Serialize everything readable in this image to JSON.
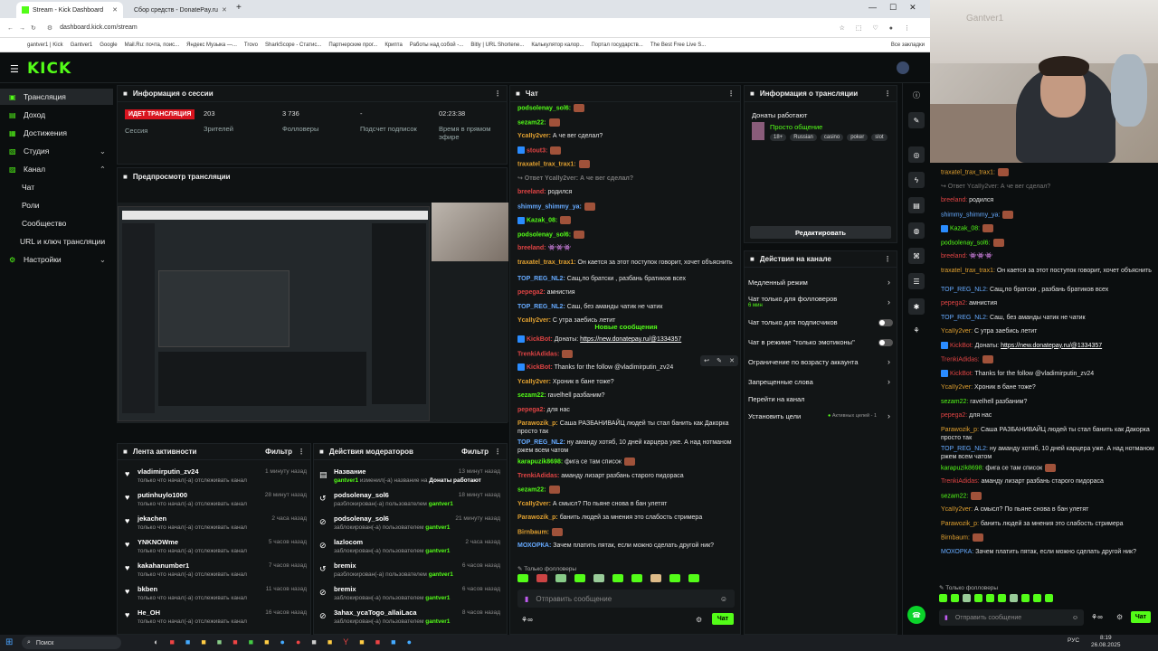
{
  "browser": {
    "tabs": [
      {
        "title": "Stream - Kick Dashboard",
        "active": true
      },
      {
        "title": "Сбор средств - DonatePay.ru",
        "active": false
      }
    ],
    "url": "dashboard.kick.com/stream",
    "bookmarks": [
      "gantver1 | Kick",
      "Gantver1",
      "Google",
      "Mail.Ru: почта, поис...",
      "Яндекс Музыка —...",
      "Trovo",
      "SharkScope - Статис...",
      "Партнерские прог...",
      "Крипта",
      "Работы над собой -...",
      "Bitly | URL Shortene...",
      "Калькулятор калор...",
      "Портал государств...",
      "The Best Free Live S..."
    ],
    "all_bookmarks": "Все закладки"
  },
  "sidebar": {
    "items": [
      {
        "label": "Трансляция",
        "icon": "broadcast-icon",
        "active": true
      },
      {
        "label": "Доход",
        "icon": "wallet-icon"
      },
      {
        "label": "Достижения",
        "icon": "trophy-icon"
      },
      {
        "label": "Студия",
        "icon": "studio-icon",
        "chevron": "down"
      },
      {
        "label": "Канал",
        "icon": "channel-icon",
        "chevron": "up"
      },
      {
        "label": "Чат",
        "sub": true
      },
      {
        "label": "Роли",
        "sub": true
      },
      {
        "label": "Сообщество",
        "sub": true
      },
      {
        "label": "URL и ключ трансляции",
        "sub": true
      },
      {
        "label": "Настройки",
        "icon": "gear-icon",
        "chevron": "down"
      }
    ]
  },
  "session": {
    "title": "Информация о сессии",
    "live_badge": "ИДЕТ ТРАНСЛЯЦИЯ",
    "session_label": "Сессия",
    "stats": [
      {
        "value": "203",
        "label": "Зрителей"
      },
      {
        "value": "3 736",
        "label": "Фолловеры"
      },
      {
        "value": "-",
        "label": "Подсчет подписок"
      },
      {
        "value": "02:23:38",
        "label": "Время в прямом эфире"
      }
    ]
  },
  "preview": {
    "title": "Предпросмотр трансляции"
  },
  "activity": {
    "title": "Лента активности",
    "filter": "Фильтр",
    "items": [
      {
        "name": "vladimirputin_zv24",
        "desc": "только что начал(-а) отслеживать канал",
        "time": "1 минуту назад"
      },
      {
        "name": "putinhuylo1000",
        "desc": "только что начал(-а) отслеживать канал",
        "time": "28 минут назад"
      },
      {
        "name": "jekachen",
        "desc": "только что начал(-а) отслеживать канал",
        "time": "2 часа назад"
      },
      {
        "name": "YNKNOWme",
        "desc": "только что начал(-а) отслеживать канал",
        "time": "5 часов назад"
      },
      {
        "name": "kakahanumber1",
        "desc": "только что начал(-а) отслеживать канал",
        "time": "7 часов назад"
      },
      {
        "name": "bkben",
        "desc": "только что начал(-а) отслеживать канал",
        "time": "11 часов назад"
      },
      {
        "name": "He_OH",
        "desc": "только что начал(-а) отслеживать канал",
        "time": "16 часов назад"
      }
    ]
  },
  "moderation": {
    "title": "Действия модераторов",
    "filter": "Фильтр",
    "items": [
      {
        "name": "Название",
        "desc_pre": "gantver1",
        "desc": " изменил(-а) название на ",
        "desc_post": "Донаты работают",
        "time": "13 минут назад",
        "icon": "rename-icon"
      },
      {
        "name": "podsolenay_sol6",
        "desc_pre": "",
        "desc": "разблокирован(-а) пользователем ",
        "desc_post": "gantver1",
        "time": "18 минут назад",
        "icon": "unban-icon"
      },
      {
        "name": "podsolenay_sol6",
        "desc_pre": "",
        "desc": "заблокирован(-а) пользователем ",
        "desc_post": "gantver1",
        "time": "21 минуту назад",
        "icon": "ban-icon"
      },
      {
        "name": "lazlocom",
        "desc_pre": "",
        "desc": "заблокирован(-а) пользователем ",
        "desc_post": "gantver1",
        "time": "2 часа назад",
        "icon": "ban-icon"
      },
      {
        "name": "bremix",
        "desc_pre": "",
        "desc": "разблокирован(-а) пользователем ",
        "desc_post": "gantver1",
        "time": "6 часов назад",
        "icon": "unban-icon"
      },
      {
        "name": "bremix",
        "desc_pre": "",
        "desc": "заблокирован(-а) пользователем ",
        "desc_post": "gantver1",
        "time": "6 часов назад",
        "icon": "ban-icon"
      },
      {
        "name": "3ahax_ycaTogo_allaiLaca",
        "desc_pre": "",
        "desc": "заблокирован(-а) пользователем ",
        "desc_post": "gantver1",
        "time": "8 часов назад",
        "icon": "ban-icon"
      }
    ]
  },
  "chat": {
    "title": "Чат",
    "new_messages": "Новые сообщения",
    "followers_only": "Только фолловеры",
    "placeholder": "Отправить сообщение",
    "send": "Чат",
    "messages": [
      {
        "user": "podsolenay_sol6:",
        "color": "#53fc18",
        "text": "",
        "emote": true
      },
      {
        "user": "sezam22:",
        "color": "#53fc18",
        "text": "",
        "emote": true
      },
      {
        "user": "YcaIIy2ver:",
        "color": "#e0a030",
        "text": "А че вег сделал?"
      },
      {
        "user": "stout3:",
        "color": "#e04444",
        "text": "",
        "emote": true,
        "badge": true
      },
      {
        "user": "traxatel_trax_trax1:",
        "color": "#e0a030",
        "text": "",
        "emote": true
      },
      {
        "user": "↪ Ответ YcaIIy2ver: А че вег сделал?",
        "color": "#777",
        "text": ""
      },
      {
        "user": "breeland:",
        "color": "#e04444",
        "text": "родился"
      },
      {
        "user": "shimmy_shimmy_ya:",
        "color": "#66aaff",
        "text": "",
        "emote": true
      },
      {
        "user": "Kazak_08:",
        "color": "#53fc18",
        "text": "",
        "emote": true,
        "badge": true
      },
      {
        "user": "podsolenay_sol6:",
        "color": "#53fc18",
        "text": "",
        "emote": true
      },
      {
        "user": "breeland:",
        "color": "#e04444",
        "text": "👾👾👾"
      },
      {
        "user": "traxatel_trax_trax1:",
        "color": "#e0a030",
        "text": "Он кается за этот поступок говорит, хочет объяснить"
      },
      {
        "user": "TOP_REG_NL2:",
        "color": "#66aaff",
        "text": "Сащ,по братски , разбань братиков всех"
      },
      {
        "user": "pepega2:",
        "color": "#e04444",
        "text": "амнистия"
      },
      {
        "user": "TOP_REG_NL2:",
        "color": "#66aaff",
        "text": "Саш, без аманды чатик не чатик"
      },
      {
        "user": "YcaIIy2ver:",
        "color": "#e0a030",
        "text": "С утра заебись летит"
      }
    ],
    "messages_new": [
      {
        "user": "KickBot:",
        "color": "#e04444",
        "text": "Донаты: ",
        "link": "https://new.donatepay.ru/@1334357",
        "badge": true
      },
      {
        "user": "TrenkiAdidas:",
        "color": "#e04444",
        "text": "",
        "emote": true
      },
      {
        "user": "KickBot:",
        "color": "#e04444",
        "text": "Thanks for the follow @vladimirputin_zv24",
        "badge": true
      },
      {
        "user": "YcaIIy2ver:",
        "color": "#e0a030",
        "text": "Хроник в бане тоже?"
      },
      {
        "user": "sezam22:",
        "color": "#53fc18",
        "text": "ravelhell разбаним?"
      },
      {
        "user": "pepega2:",
        "color": "#e04444",
        "text": "для нас"
      },
      {
        "user": "Parawozik_p:",
        "color": "#e0a030",
        "text": "Саша РАЗБАНИВАЙЦ людей ты стал банить как Дакорка просто так"
      },
      {
        "user": "TOP_REG_NL2:",
        "color": "#66aaff",
        "text": "ну аманду хотяб, 10 дней карцера уже. А над нотманом ржем всем чатом"
      },
      {
        "user": "karapuzik8698:",
        "color": "#53fc18",
        "text": "фига се там список",
        "emote": true
      },
      {
        "user": "TrenkiAdidas:",
        "color": "#e04444",
        "text": "аманду лизарт разбань старого пидораса"
      },
      {
        "user": "sezam22:",
        "color": "#53fc18",
        "text": "",
        "emote": true
      },
      {
        "user": "YcaIIy2ver:",
        "color": "#e0a030",
        "text": "А смысл? По пьяне снова в бан улетят"
      },
      {
        "user": "Parawozik_p:",
        "color": "#e0a030",
        "text": "банить людей за мнения это слабость стримера"
      },
      {
        "user": "Birnbaum:",
        "color": "#e0a030",
        "text": "",
        "emote": true
      },
      {
        "user": "МОХОРКА:",
        "color": "#66aaff",
        "text": "Зачем платить пятак, если можно сделать другой ник?"
      }
    ]
  },
  "stream_info": {
    "title": "Информация о трансляции",
    "donations": "Донаты работают",
    "category": "Просто общение",
    "tags": [
      "18+",
      "Russian",
      "casino",
      "poker",
      "slot"
    ],
    "edit": "Редактировать"
  },
  "channel_actions": {
    "title": "Действия на канале",
    "items": [
      {
        "label": "Медленный режим",
        "type": "chevron"
      },
      {
        "label": "Чат только для фолловеров",
        "sub": "6 мин",
        "type": "chevron"
      },
      {
        "label": "Чат только для подписчиков",
        "type": "toggle"
      },
      {
        "label": "Чат в режиме \"только эмотиконы\"",
        "type": "toggle"
      },
      {
        "label": "Ограничение по возрасту аккаунта",
        "type": "chevron"
      },
      {
        "label": "Запрещенные слова",
        "type": "chevron"
      },
      {
        "label": "Перейти на канал",
        "type": "none"
      },
      {
        "label": "Установить цели",
        "sub": "Активных целей - 1",
        "type": "chevron"
      }
    ]
  },
  "overlay_chat": {
    "placeholder": "Отправить сообщение",
    "send": "Чат",
    "followers_only": "Только фолловеры"
  },
  "taskbar": {
    "search": "Поиск",
    "time": "8:19",
    "date": "26.08.2025",
    "lang": "РУС"
  },
  "webcam_watermark": "Gantver1"
}
